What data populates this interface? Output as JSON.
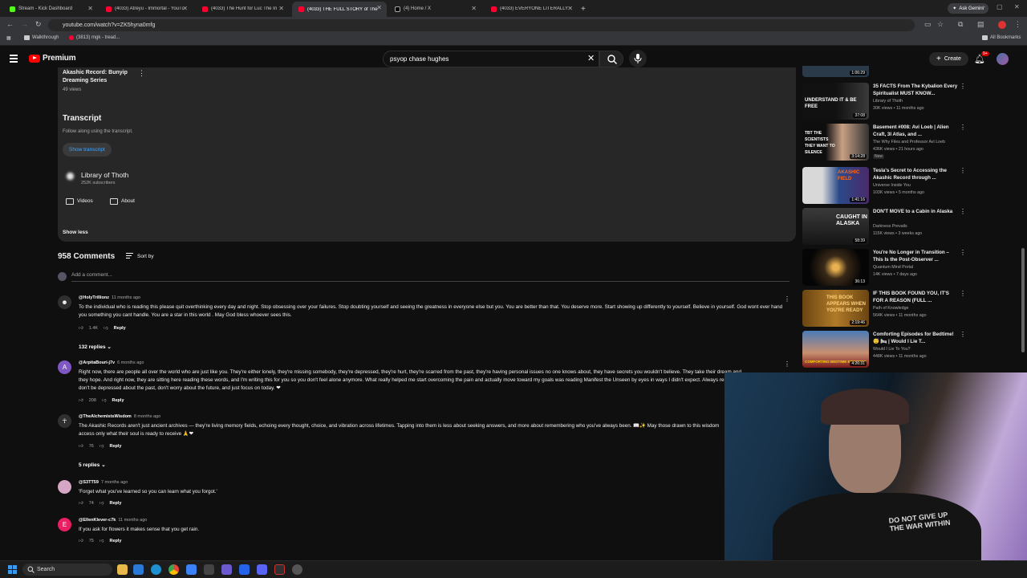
{
  "browser": {
    "tabs": [
      {
        "title": "Stream - Kick Dashboard",
        "favicon": "kick"
      },
      {
        "title": "(4033) Atreyu - Immortal - YouTube",
        "favicon": "youtube"
      },
      {
        "title": "(4033) The Hunt for Luc The In",
        "favicon": "youtube"
      },
      {
        "title": "(4033) THE FULL STORY of The A",
        "favicon": "youtube"
      },
      {
        "title": "(4) Home / X",
        "favicon": "x"
      },
      {
        "title": "(4033) EVERYONE LITERALLY CH",
        "favicon": "youtube"
      }
    ],
    "ask_gemini": "Ask Gemini",
    "url": "youtube.com/watch?v=ZK5hyna0mfg",
    "bookmarks": [
      "Walkthrough",
      "(3813) mgk - tread..."
    ],
    "all_bookmarks": "All Bookmarks"
  },
  "youtube": {
    "logo_text": "Premium",
    "search_query": "psyop chase hughes",
    "create_label": "Create",
    "notifications_badge": "9+"
  },
  "description": {
    "series_title": "Akashic Record: Bunyip Dreaming Series",
    "series_views": "49 views",
    "transcript_heading": "Transcript",
    "transcript_sub": "Follow along using the transcript.",
    "show_transcript": "Show transcript",
    "channel_name": "Library of Thoth",
    "channel_subs": "252K subscribers",
    "videos_label": "Videos",
    "about_label": "About",
    "show_less": "Show less"
  },
  "comments_section": {
    "count": "958 Comments",
    "sort_label": "Sort by",
    "add_placeholder": "Add a comment..."
  },
  "comments": [
    {
      "author": "@HolyTrillionz",
      "time": "11 months ago",
      "text": "To the individual who is reading this please quit overthinking every day and night. Stop obsessing over your failures. Stop doubting yourself and seeing the greatness in everyone else but you. You are better than that. You deserve more. Start showing up differently to yourself. Believe in yourself. God wont ever hand you something you cant handle. You are a star in this world . May God bless whoever sees this.",
      "likes": "1.4K",
      "replies": "132 replies"
    },
    {
      "author": "@ArpitaBouri-j7v",
      "time": "6 months ago",
      "text": "Right now, there are people all over the world who are just like you. They're either lonely, they're missing somebody, they're depressed, they're hurt, they're scarred from the past, they're having personal issues no one knows about, they have secrets you wouldn't believe. They take their dream and they hope. And right now, they are sitting here reading these words, and I'm writing this for you so you don't feel alone anymore. What really helped me start overcoming the pain and actually move toward my goals was reading Manifest the Unseen by eyes in ways I didn't expect. Always remember, don't be depressed about the past, don't worry about the future, and just focus on today. ❤",
      "likes": "208",
      "replies": ""
    },
    {
      "author": "@TheAlchemistsWisdom",
      "time": "8 months ago",
      "text": "The Akashic Records aren't just ancient archives — they're living memory fields, echoing every thought, choice, and vibration across lifetimes. Tapping into them is less about seeking answers, and more about remembering who you've always been. 📖✨ May those drawn to this wisdom access only what their soul is ready to receive 🙏❤",
      "likes": "76",
      "replies": "5 replies"
    },
    {
      "author": "@S3TT59",
      "time": "7 months ago",
      "text": "'Forget what you've learned so you can learn what you forgot.'",
      "likes": "74",
      "replies": ""
    },
    {
      "author": "@EllenKlever-c7k",
      "time": "11 months ago",
      "text": "If you ask for flowers it makes sense that you get rain.",
      "likes": "75",
      "replies": ""
    }
  ],
  "recommendations": [
    {
      "title": "",
      "channel": "",
      "meta": "",
      "duration": "1:06:29",
      "thumb_text": ""
    },
    {
      "title": "35 FACTS From The Kybalion Every Spiritualist MUST KNOW...",
      "channel": "Library of Thoth",
      "meta": "30K views • 11 months ago",
      "duration": "37:08",
      "thumb_text": "UNDERSTAND IT & BE FREE"
    },
    {
      "title": "Basement #008: Avi Loeb | Alien Craft, 3I Atlas, and ...",
      "channel": "The Why Files and Professor Avi Loeb",
      "meta": "436K views • 21 hours ago",
      "duration": "3:14:28",
      "thumb_text": "TBT THE SCIENTISTS THEY WANT TO SILENCE",
      "badge": "New"
    },
    {
      "title": "Tesla's Secret to Accessing the Akashic Record through ...",
      "channel": "Universe Inside You",
      "meta": "103K views • 5 months ago",
      "duration": "1:41:16",
      "thumb_text": "AKASHIC FIELD"
    },
    {
      "title": "DON'T MOVE to a Cabin in Alaska",
      "channel": "Darkness Prevails",
      "meta": "115K views • 3 weeks ago",
      "duration": "58:39",
      "thumb_text": "CAUGHT IN ALASKA"
    },
    {
      "title": "You're No Longer in Transition – This Is the Post-Observer ...",
      "channel": "Quantum Mind Portal",
      "meta": "14K views • 7 days ago",
      "duration": "36:13",
      "thumb_text": ""
    },
    {
      "title": "IF THIS BOOK FOUND YOU, IT'S FOR A REASON (FULL ...",
      "channel": "Path of Knowledge",
      "meta": "564K views • 11 months ago",
      "duration": "2:19:46",
      "thumb_text": "THIS BOOK APPEARS WHEN YOU'RE READY"
    },
    {
      "title": "Comforting Episodes for Bedtime! 😴 🛏 | Would I Lie T...",
      "channel": "Would I Lie To You?",
      "meta": "448K views • 11 months ago",
      "duration": "4:26:31",
      "thumb_text": "COMFORTING BEDTIME EPISODES"
    }
  ],
  "webcam": {
    "shirt_text": "DO NOT GIVE UP THE WAR WITHIN"
  },
  "taskbar": {
    "search_label": "Search"
  },
  "colors": {
    "yt_red": "#ff0000",
    "link_blue": "#3ea6ff",
    "background": "#0f0f0f",
    "panel": "#272727"
  }
}
